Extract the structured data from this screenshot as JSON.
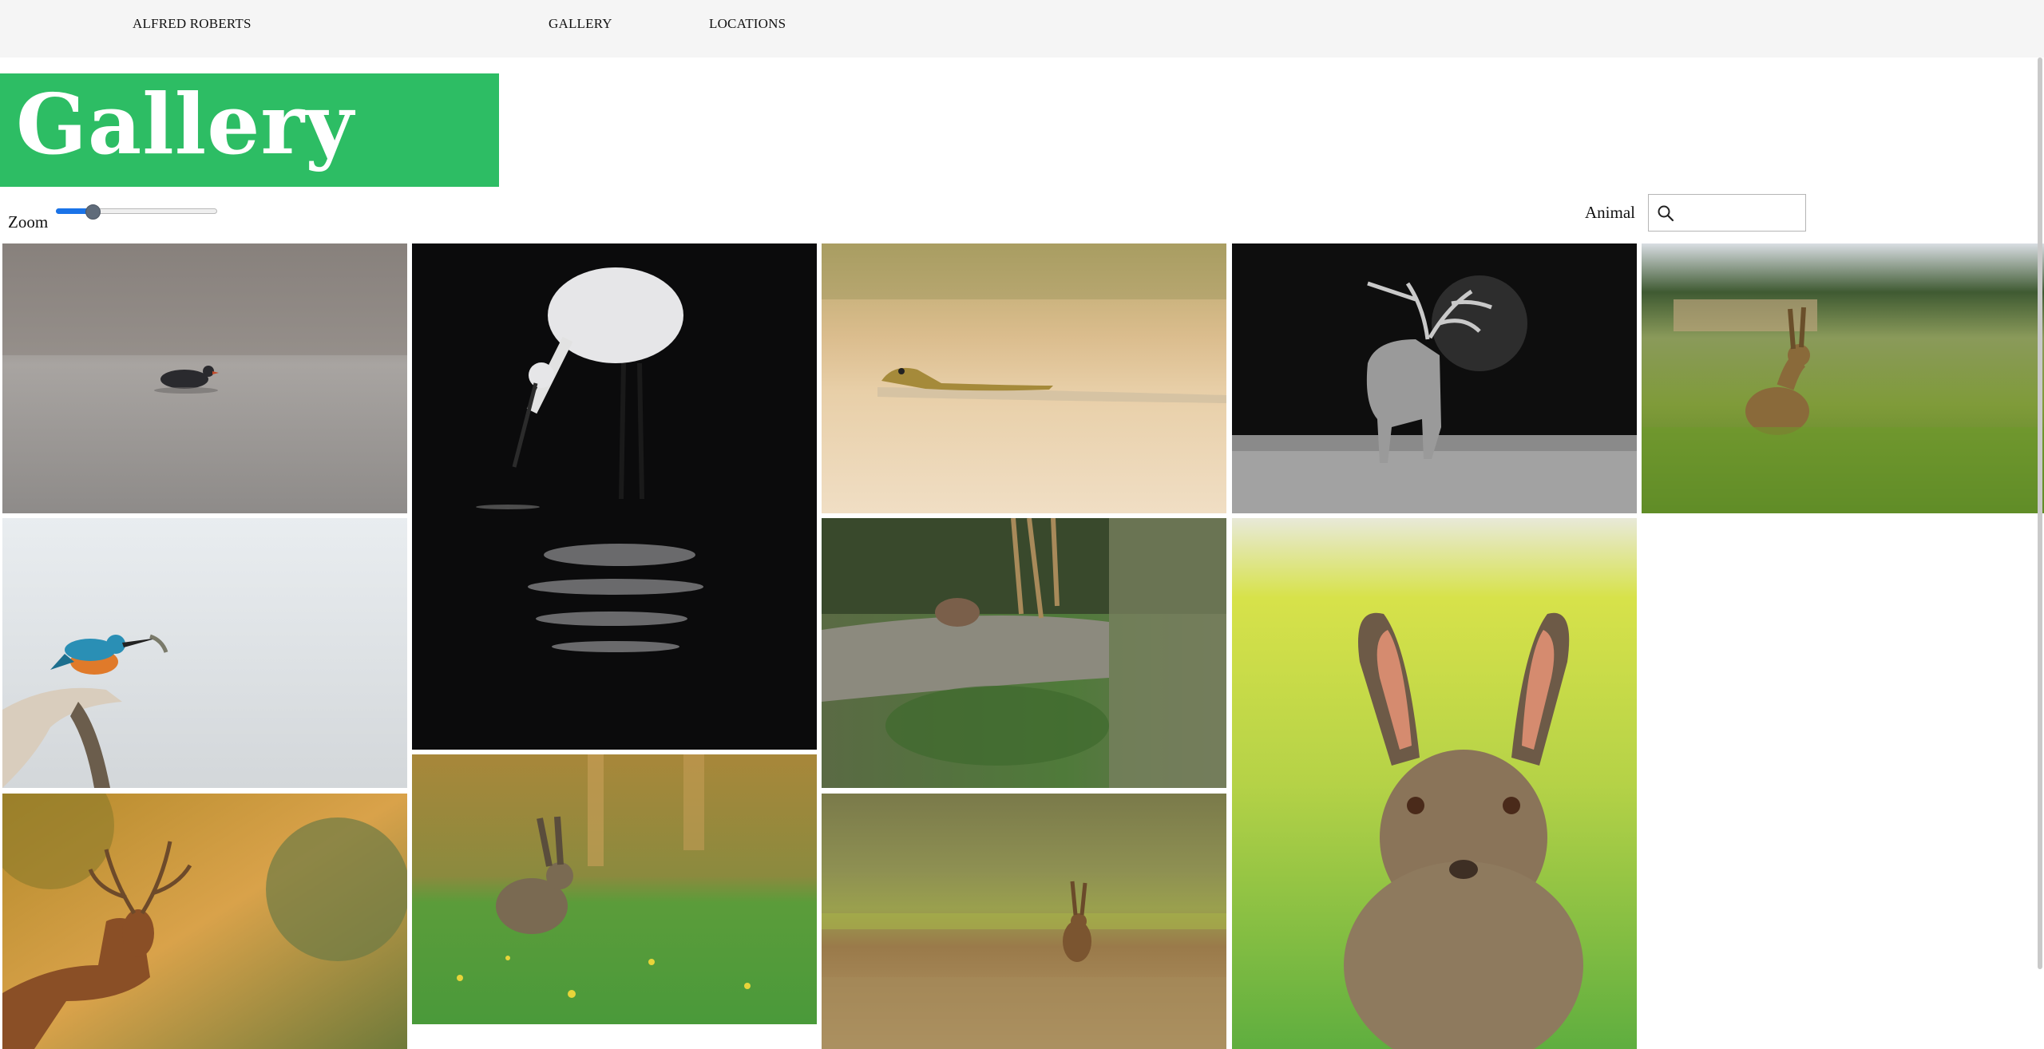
{
  "nav": {
    "brand": "ALFRED ROBERTS",
    "links": [
      "GALLERY",
      "LOCATIONS"
    ]
  },
  "page": {
    "title": "Gallery"
  },
  "controls": {
    "zoom_label": "Zoom",
    "zoom_level": 0.2,
    "filter_label": "Animal",
    "search_value": ""
  },
  "colors": {
    "accent": "#2dbd64",
    "topbar": "#f5f5f5",
    "slider_fill": "#1a73e8"
  },
  "gallery": {
    "photos": [
      {
        "subject": "moorhen-on-misty-lake"
      },
      {
        "subject": "egret-fishing-at-night"
      },
      {
        "subject": "lizard-on-rock"
      },
      {
        "subject": "black-and-white-stag"
      },
      {
        "subject": "hare-in-field"
      },
      {
        "subject": "kingfisher-with-fish"
      },
      {
        "subject": "vole-in-undergrowth"
      },
      {
        "subject": "close-up-hare"
      },
      {
        "subject": "hare-on-spring-meadow"
      },
      {
        "subject": "stag-in-autumn-woods"
      },
      {
        "subject": "hare-in-stubble-field"
      }
    ]
  }
}
